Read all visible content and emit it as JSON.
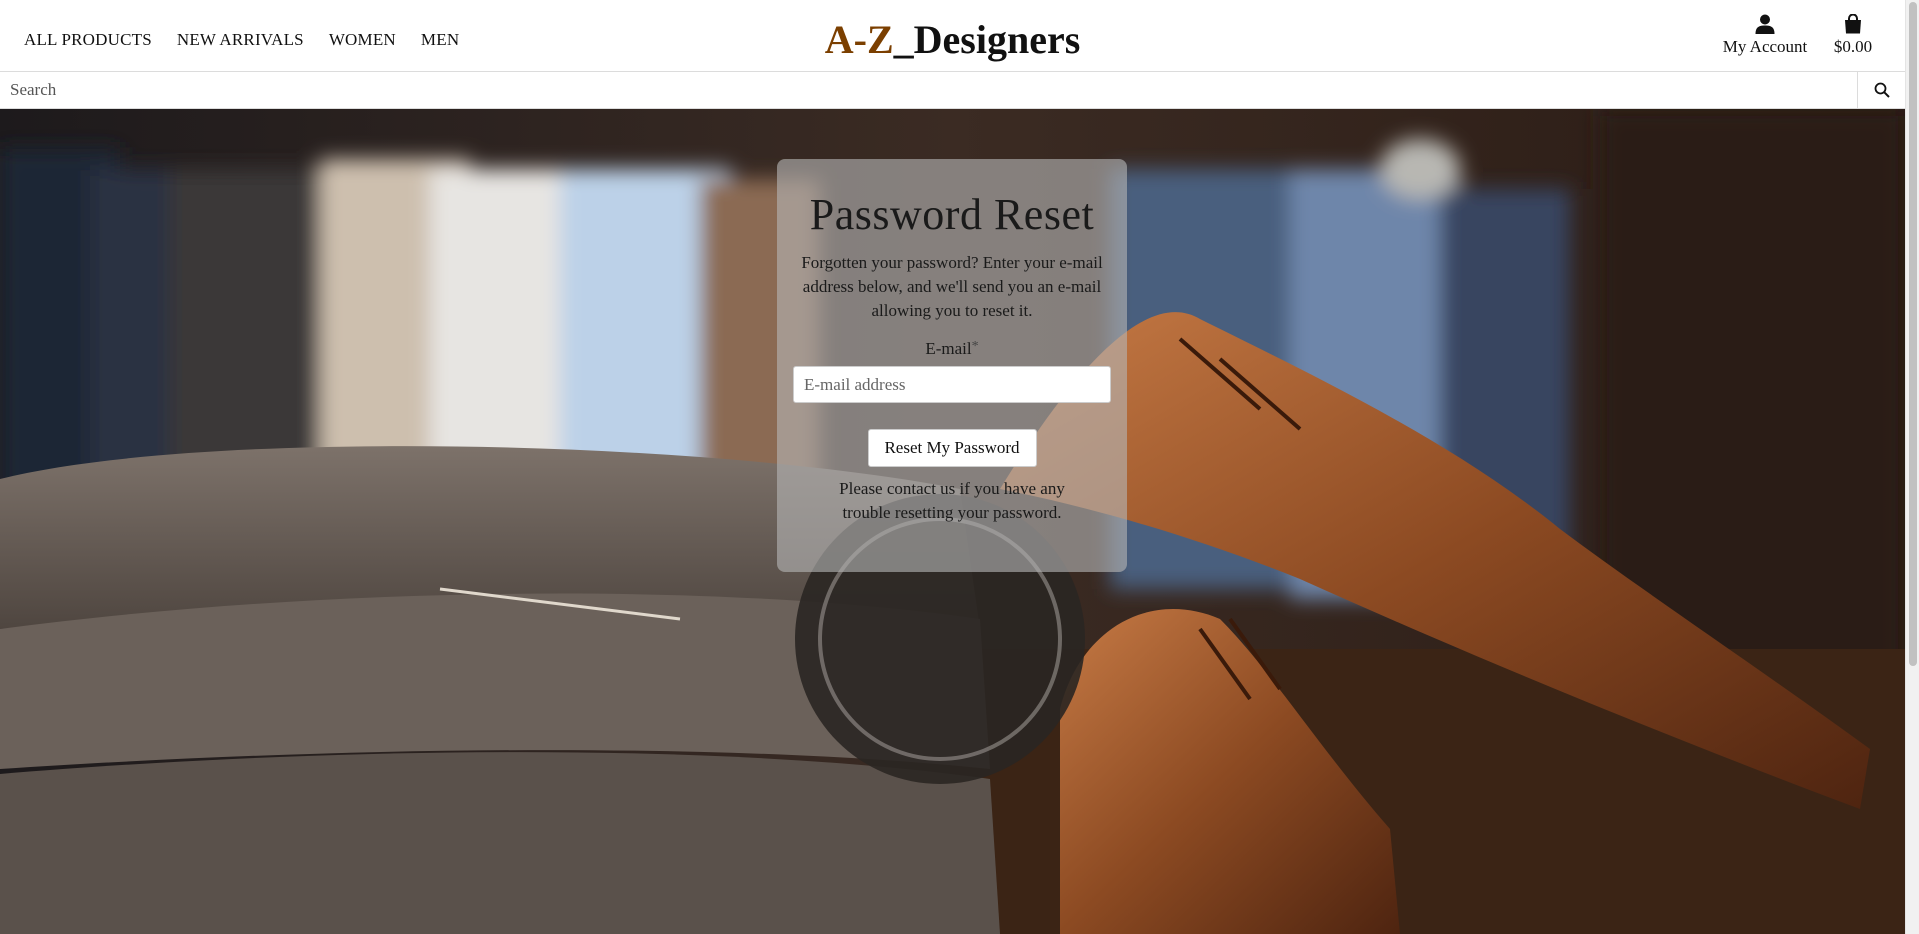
{
  "nav": {
    "items": [
      {
        "label": "ALL PRODUCTS"
      },
      {
        "label": "NEW ARRIVALS"
      },
      {
        "label": "WOMEN"
      },
      {
        "label": "MEN"
      }
    ]
  },
  "logo": {
    "part1": "A-Z",
    "part2": "_Designers"
  },
  "account": {
    "label": "My Account",
    "icon": "user-icon"
  },
  "cart": {
    "total": "$0.00",
    "icon": "shopping-bag-icon"
  },
  "search": {
    "placeholder": "Search",
    "value": "",
    "icon": "search-icon"
  },
  "reset_form": {
    "title": "Password Reset",
    "intro": "Forgotten your password? Enter your e-mail address below, and we'll send you an e-mail allowing you to reset it.",
    "email_label": "E-mail",
    "required_mark": "*",
    "email_placeholder": "E-mail address",
    "email_value": "",
    "submit_label": "Reset My Password",
    "help_text": "Please contact us if you have any trouble resetting your password."
  },
  "colors": {
    "brand_accent": "#7b3f00",
    "text": "#111111",
    "card_overlay": "rgba(180,180,180,0.62)"
  }
}
